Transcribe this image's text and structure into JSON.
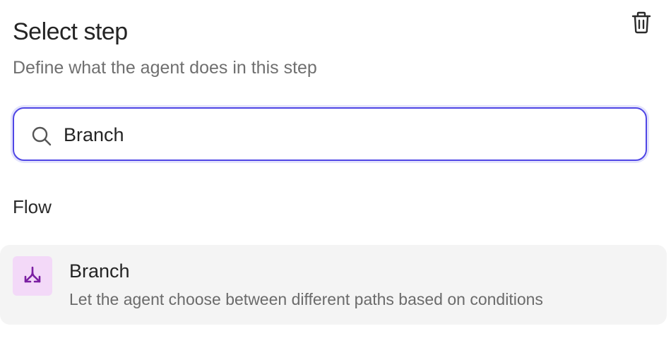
{
  "header": {
    "title": "Select step",
    "subtitle": "Define what the agent does in this step",
    "delete_icon": "trash-icon"
  },
  "search": {
    "value": "Branch",
    "icon": "search-icon"
  },
  "sections": [
    {
      "title": "Flow",
      "items": [
        {
          "title": "Branch",
          "description": "Let the agent choose between different paths based on conditions",
          "icon": "branch-icon",
          "icon_color": "#7b1fa2",
          "icon_bg": "#f3d9f8"
        }
      ]
    }
  ],
  "colors": {
    "accent": "#4f46e5"
  }
}
